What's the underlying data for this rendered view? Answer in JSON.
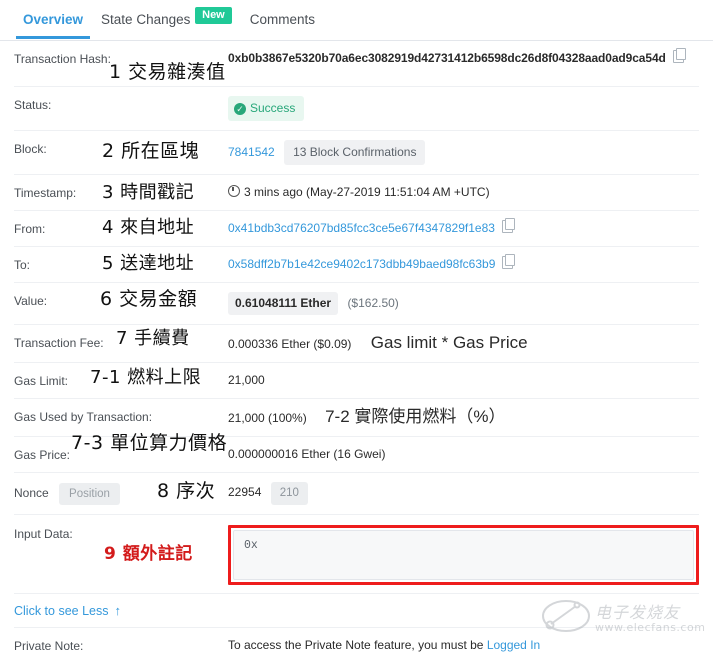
{
  "tabs": [
    {
      "label": "Overview",
      "active": true,
      "badge": null
    },
    {
      "label": "State Changes",
      "active": false,
      "badge": "New"
    },
    {
      "label": "Comments",
      "active": false,
      "badge": null
    }
  ],
  "rows": {
    "tx_hash": {
      "label": "Transaction Hash:",
      "value": "0xb0b3867e5320b70a6ec3082919d42731412b6598dc26d8f04328aad0ad9ca54d",
      "annotation": "1 交易雜湊值"
    },
    "status": {
      "label": "Status:",
      "value": "Success"
    },
    "block": {
      "label": "Block:",
      "number": "7841542",
      "confirmations": "13 Block Confirmations",
      "annotation": "2 所在區塊"
    },
    "timestamp": {
      "label": "Timestamp:",
      "value": "3 mins ago (May-27-2019 11:51:04 AM +UTC)",
      "annotation": "3 時間戳記"
    },
    "from": {
      "label": "From:",
      "value": "0x41bdb3cd76207bd85fcc3ce5e67f4347829f1e83",
      "annotation": "4 來自地址"
    },
    "to": {
      "label": "To:",
      "value": "0x58dff2b7b1e42ce9402c173dbb49baed98fc63b9",
      "annotation": "5 送達地址"
    },
    "value": {
      "label": "Value:",
      "ether": "0.61048111 Ether",
      "usd": "($162.50)",
      "annotation": "6 交易金額"
    },
    "tx_fee": {
      "label": "Transaction Fee:",
      "value": "0.000336 Ether ($0.09)",
      "annotation": "7 手續費",
      "note": "Gas limit * Gas Price"
    },
    "gas_limit": {
      "label": "Gas Limit:",
      "value": "21,000",
      "annotation": "7-1 燃料上限"
    },
    "gas_used": {
      "label": "Gas Used by Transaction:",
      "value": "21,000 (100%)",
      "annotation": "7-2 實際使用燃料（%）"
    },
    "gas_price": {
      "label": "Gas Price:",
      "value": "0.000000016 Ether (16 Gwei)",
      "annotation": "7-3 單位算力價格"
    },
    "nonce": {
      "label": "Nonce",
      "position_label": "Position",
      "nonce_value": "22954",
      "position_value": "210",
      "annotation": "8 序次"
    },
    "input_data": {
      "label": "Input Data:",
      "value": "0x",
      "annotation": "9 額外註記"
    },
    "see_less": {
      "label": "Click to see Less",
      "arrow": "↑"
    },
    "private_note": {
      "label": "Private Note:",
      "text": "To access the Private Note feature, you must be",
      "link": "Logged In"
    }
  },
  "watermark": {
    "text": "电子发烧友",
    "url": "www.elecfans.com"
  },
  "colors": {
    "accent_blue": "#3498db",
    "success_green": "#28a77a",
    "badge_green": "#20c997",
    "annotation_red": "#d31b1b"
  }
}
